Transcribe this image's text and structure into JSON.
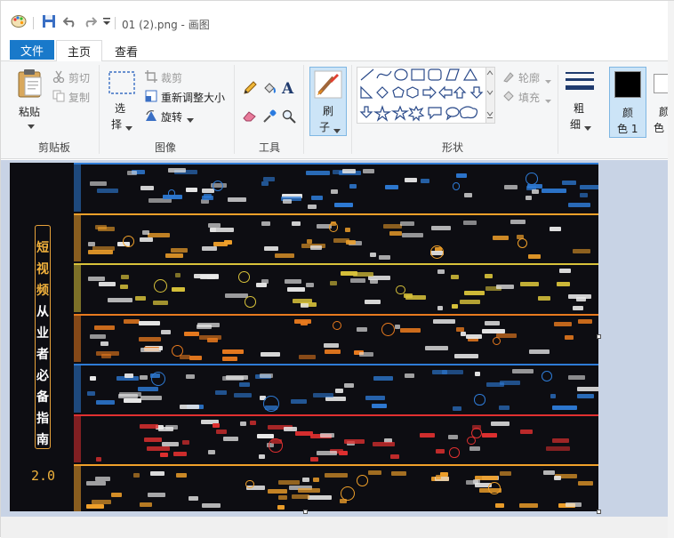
{
  "window": {
    "title": "01 (2).png - 画图"
  },
  "tabs": {
    "file": "文件",
    "home": "主页",
    "view": "查看"
  },
  "clipboard": {
    "paste": "粘贴",
    "cut": "剪切",
    "copy": "复制",
    "group": "剪贴板"
  },
  "image": {
    "select_line1": "选",
    "select_line2": "择",
    "crop": "裁剪",
    "resize": "重新调整大小",
    "rotate": "旋转",
    "group": "图像"
  },
  "tools": {
    "text_icon": "A",
    "group": "工具"
  },
  "brush": {
    "line1": "刷",
    "line2": "子"
  },
  "shapes": {
    "outline": "轮廓",
    "fill": "填充",
    "group": "形状"
  },
  "size": {
    "line1": "粗",
    "line2": "细"
  },
  "colors": {
    "color1_line1": "颜",
    "color1_line2": "色 1",
    "color2_line1": "颜",
    "color2_line2": "色",
    "accent": "#1979ca",
    "primary_color": "#000000"
  },
  "poster": {
    "title_chars": [
      "短",
      "视",
      "频",
      "从",
      "业",
      "者",
      "必",
      "备",
      "指",
      "南"
    ],
    "version": "2.0",
    "band_colors": [
      "#2e7bd6",
      "#f0a02a",
      "#d8c23a",
      "#e87a1e",
      "#2e7bd6",
      "#e03030",
      "#f0a02a"
    ]
  }
}
